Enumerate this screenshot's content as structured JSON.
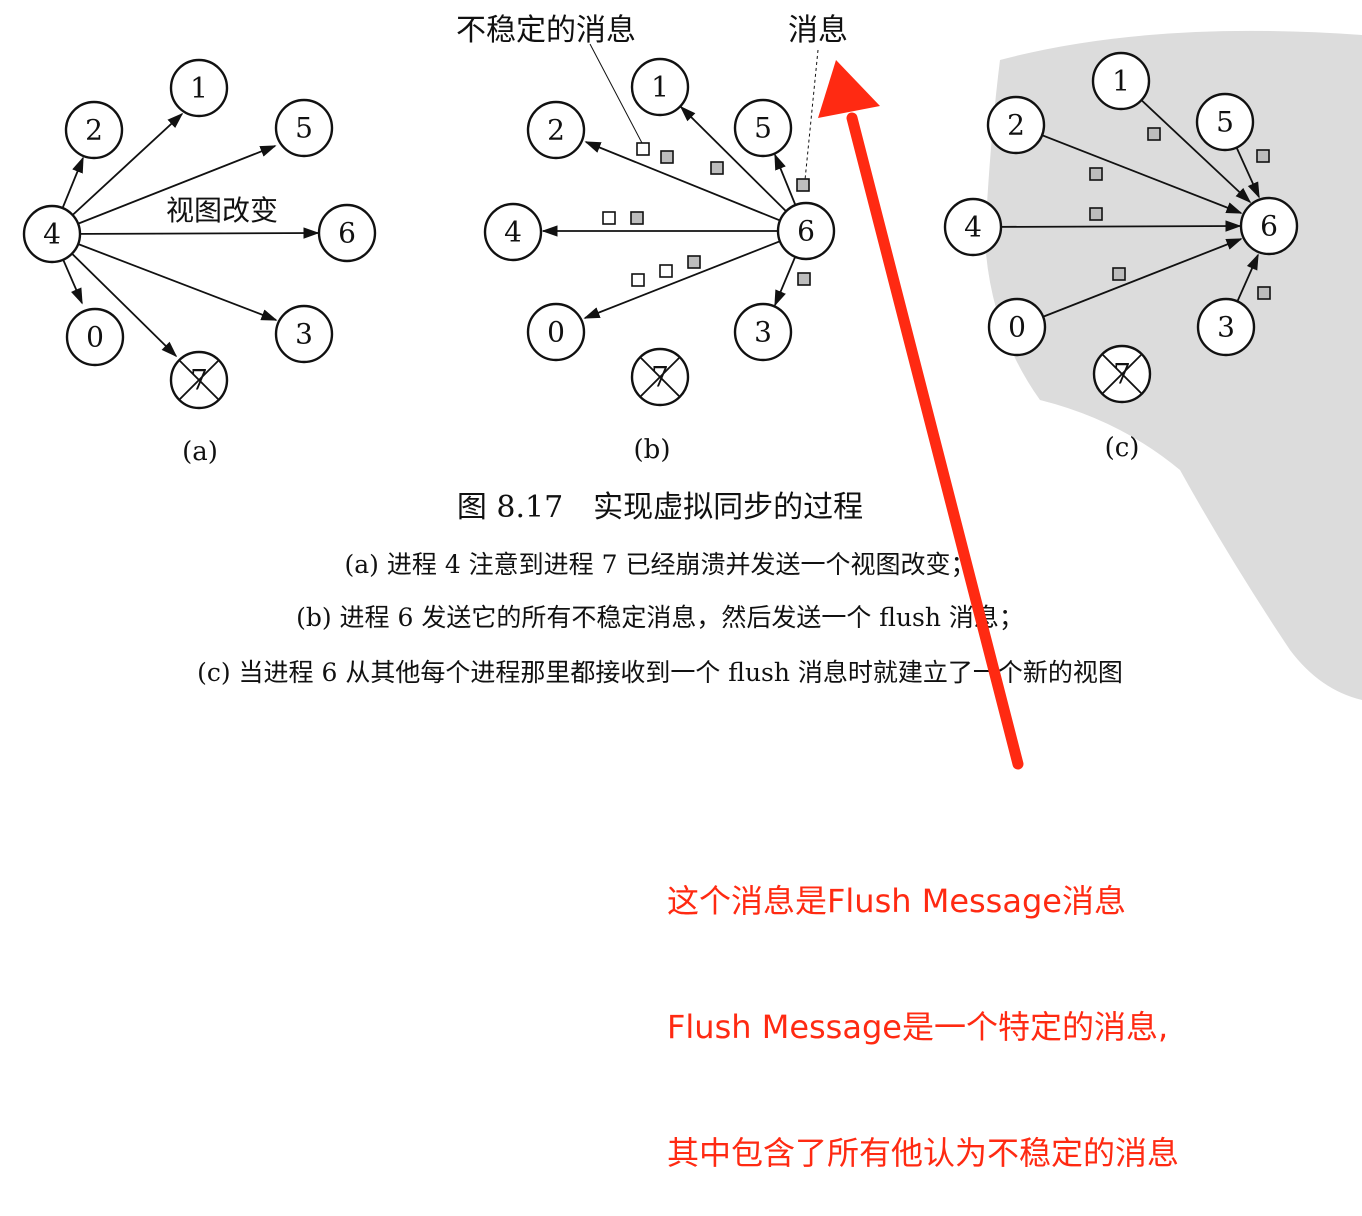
{
  "labels": {
    "unstable_message": "不稳定的消息",
    "message": "消息",
    "view_change": "视图改变"
  },
  "panels": [
    {
      "label": "(a)",
      "nodes": [
        "0",
        "1",
        "2",
        "3",
        "4",
        "5",
        "6",
        "7"
      ],
      "crashed": "7"
    },
    {
      "label": "(b)",
      "nodes": [
        "0",
        "1",
        "2",
        "3",
        "4",
        "5",
        "6",
        "7"
      ],
      "crashed": "7"
    },
    {
      "label": "(c)",
      "nodes": [
        "0",
        "1",
        "2",
        "3",
        "4",
        "5",
        "6",
        "7"
      ],
      "crashed": "7"
    }
  ],
  "caption": {
    "title": "图 8.17　实现虚拟同步的过程",
    "lines": [
      "(a) 进程 4 注意到进程 7 已经崩溃并发送一个视图改变；",
      "(b) 进程 6 发送它的所有不稳定消息，然后发送一个 flush 消息；",
      "(c) 当进程 6 从其他每个进程那里都接收到一个 flush 消息时就建立了一个新的视图"
    ]
  },
  "annotation": {
    "lines": [
      "这个消息是Flush Message消息",
      "Flush Message是一个特定的消息,",
      "其中包含了所有他认为不稳定的消息"
    ],
    "color": "#ff2a12"
  }
}
